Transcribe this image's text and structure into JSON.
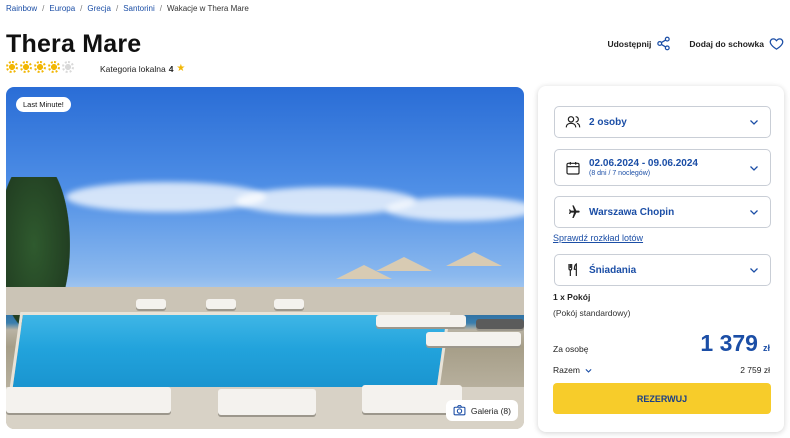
{
  "breadcrumb": {
    "items": [
      "Rainbow",
      "Europa",
      "Grecja",
      "Santorini"
    ],
    "current": "Wakacje w Thera Mare",
    "separator": "/"
  },
  "hotel": {
    "name": "Thera Mare",
    "stars_filled": 4,
    "stars_total": 5,
    "local_category_label": "Kategoria lokalna",
    "local_category_value": "4",
    "local_category_icon": "star-icon"
  },
  "actions": {
    "share_label": "Udostępnij",
    "share_icon": "share-icon",
    "favorite_label": "Dodaj do schowka",
    "favorite_icon": "heart-icon"
  },
  "photo": {
    "badge": "Last Minute!",
    "gallery_label": "Galeria (8)",
    "gallery_icon": "camera-icon"
  },
  "booking": {
    "persons": "2 osoby",
    "dates": "02.06.2024 - 09.06.2024",
    "dates_sub": "(8 dni / 7 noclegów)",
    "departure": "Warszawa Chopin",
    "flight_schedule_link": "Sprawdź rozkład lotów",
    "board": "Śniadania",
    "room_count": "1 x Pokój",
    "room_type": "(Pokój standardowy)",
    "per_person_label": "Za osobę",
    "price": "1 379",
    "currency": "zł",
    "total_label": "Razem",
    "total_value": "2 759 zł",
    "reserve_button": "REZERWUJ"
  },
  "colors": {
    "accent_blue": "#1b4ea6",
    "reserve_yellow": "#f7cc2a",
    "star_yellow": "#f2b705"
  }
}
